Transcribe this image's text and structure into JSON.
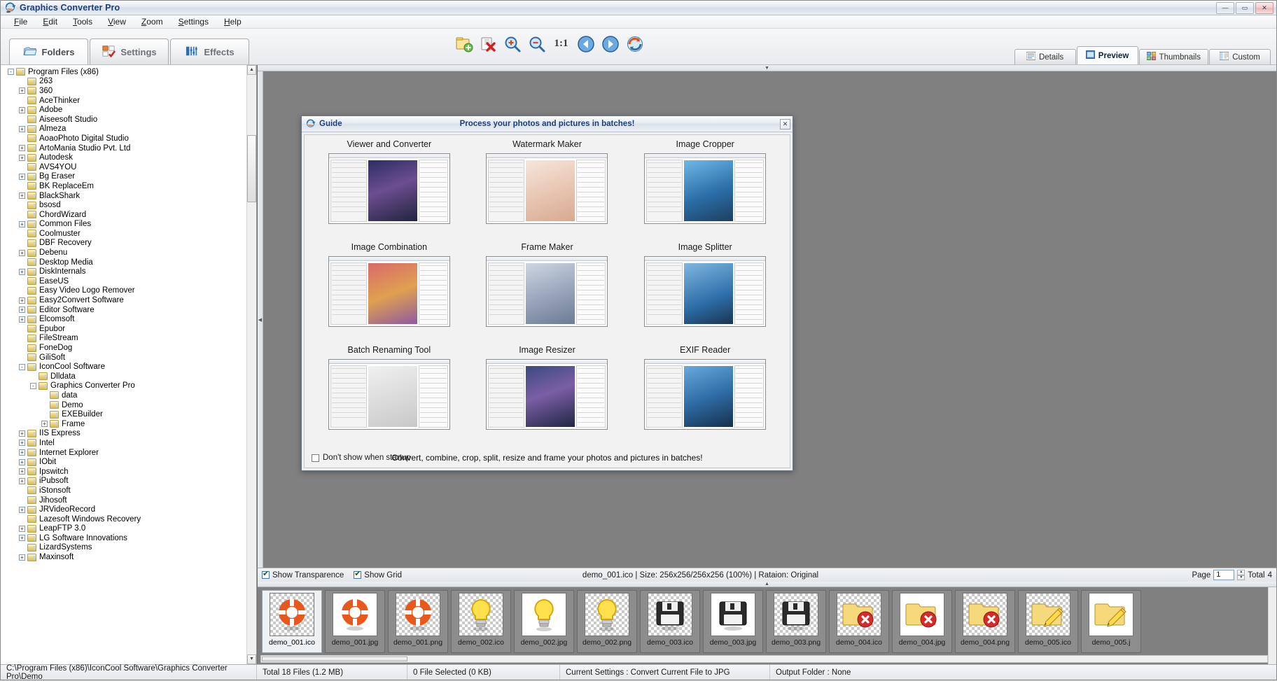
{
  "window": {
    "title": "Graphics Converter Pro",
    "buttons": {
      "minimize": "—",
      "maximize": "▭",
      "close": "✕"
    }
  },
  "menu": [
    {
      "label": "File"
    },
    {
      "label": "Edit"
    },
    {
      "label": "Tools"
    },
    {
      "label": "View"
    },
    {
      "label": "Zoom"
    },
    {
      "label": "Settings"
    },
    {
      "label": "Help"
    }
  ],
  "mode_tabs": [
    {
      "label": "Folders",
      "icon": "folder-icon",
      "active": true
    },
    {
      "label": "Settings",
      "icon": "settings-icon",
      "active": false
    },
    {
      "label": "Effects",
      "icon": "effects-icon",
      "active": false
    }
  ],
  "toolbar": [
    {
      "name": "add-files-icon",
      "glyph": "🗋"
    },
    {
      "name": "delete-icon",
      "glyph": "✖"
    },
    {
      "name": "zoom-in-icon",
      "glyph": "⊕"
    },
    {
      "name": "zoom-out-icon",
      "glyph": "⊖"
    },
    {
      "name": "actual-size-icon",
      "glyph": "1:1"
    },
    {
      "name": "previous-icon",
      "glyph": "◀"
    },
    {
      "name": "next-icon",
      "glyph": "▶"
    },
    {
      "name": "refresh-icon",
      "glyph": "↻"
    }
  ],
  "view_tabs": [
    {
      "label": "Details",
      "icon": "details-icon",
      "active": false
    },
    {
      "label": "Preview",
      "icon": "preview-icon",
      "active": true
    },
    {
      "label": "Thumbnails",
      "icon": "thumbnails-icon",
      "active": false
    },
    {
      "label": "Custom",
      "icon": "custom-icon",
      "active": false
    }
  ],
  "tree": [
    {
      "label": "Program Files (x86)",
      "depth": 2,
      "exp": "-"
    },
    {
      "label": "263",
      "depth": 3,
      "exp": ""
    },
    {
      "label": "360",
      "depth": 3,
      "exp": "+"
    },
    {
      "label": "AceThinker",
      "depth": 3,
      "exp": ""
    },
    {
      "label": "Adobe",
      "depth": 3,
      "exp": "+"
    },
    {
      "label": "Aiseesoft Studio",
      "depth": 3,
      "exp": ""
    },
    {
      "label": "Almeza",
      "depth": 3,
      "exp": "+"
    },
    {
      "label": "AoaoPhoto Digital Studio",
      "depth": 3,
      "exp": ""
    },
    {
      "label": "ArtoMania Studio Pvt. Ltd",
      "depth": 3,
      "exp": "+"
    },
    {
      "label": "Autodesk",
      "depth": 3,
      "exp": "+"
    },
    {
      "label": "AVS4YOU",
      "depth": 3,
      "exp": ""
    },
    {
      "label": "Bg Eraser",
      "depth": 3,
      "exp": "+"
    },
    {
      "label": "BK ReplaceEm",
      "depth": 3,
      "exp": ""
    },
    {
      "label": "BlackShark",
      "depth": 3,
      "exp": "+"
    },
    {
      "label": "bsosd",
      "depth": 3,
      "exp": ""
    },
    {
      "label": "ChordWizard",
      "depth": 3,
      "exp": ""
    },
    {
      "label": "Common Files",
      "depth": 3,
      "exp": "+"
    },
    {
      "label": "Coolmuster",
      "depth": 3,
      "exp": ""
    },
    {
      "label": "DBF Recovery",
      "depth": 3,
      "exp": ""
    },
    {
      "label": "Debenu",
      "depth": 3,
      "exp": "+"
    },
    {
      "label": "Desktop Media",
      "depth": 3,
      "exp": ""
    },
    {
      "label": "DiskInternals",
      "depth": 3,
      "exp": "+"
    },
    {
      "label": "EaseUS",
      "depth": 3,
      "exp": ""
    },
    {
      "label": "Easy Video Logo Remover",
      "depth": 3,
      "exp": ""
    },
    {
      "label": "Easy2Convert Software",
      "depth": 3,
      "exp": "+"
    },
    {
      "label": "Editor Software",
      "depth": 3,
      "exp": "+"
    },
    {
      "label": "Elcomsoft",
      "depth": 3,
      "exp": "+"
    },
    {
      "label": "Epubor",
      "depth": 3,
      "exp": ""
    },
    {
      "label": "FileStream",
      "depth": 3,
      "exp": ""
    },
    {
      "label": "FoneDog",
      "depth": 3,
      "exp": ""
    },
    {
      "label": "GiliSoft",
      "depth": 3,
      "exp": ""
    },
    {
      "label": "IconCool Software",
      "depth": 3,
      "exp": "-"
    },
    {
      "label": "Dlldata",
      "depth": 4,
      "exp": ""
    },
    {
      "label": "Graphics Converter Pro",
      "depth": 4,
      "exp": "-"
    },
    {
      "label": "data",
      "depth": 5,
      "exp": ""
    },
    {
      "label": "Demo",
      "depth": 5,
      "exp": ""
    },
    {
      "label": "EXEBuilder",
      "depth": 5,
      "exp": ""
    },
    {
      "label": "Frame",
      "depth": 5,
      "exp": "+"
    },
    {
      "label": "IIS Express",
      "depth": 3,
      "exp": "+"
    },
    {
      "label": "Intel",
      "depth": 3,
      "exp": "+"
    },
    {
      "label": "Internet Explorer",
      "depth": 3,
      "exp": "+"
    },
    {
      "label": "IObit",
      "depth": 3,
      "exp": "+"
    },
    {
      "label": "Ipswitch",
      "depth": 3,
      "exp": "+"
    },
    {
      "label": "iPubsoft",
      "depth": 3,
      "exp": "+"
    },
    {
      "label": "iStonsoft",
      "depth": 3,
      "exp": ""
    },
    {
      "label": "Jihosoft",
      "depth": 3,
      "exp": ""
    },
    {
      "label": "JRVideoRecord",
      "depth": 3,
      "exp": "+"
    },
    {
      "label": "Lazesoft Windows Recovery",
      "depth": 3,
      "exp": ""
    },
    {
      "label": "LeapFTP 3.0",
      "depth": 3,
      "exp": "+"
    },
    {
      "label": "LG Software Innovations",
      "depth": 3,
      "exp": "+"
    },
    {
      "label": "LizardSystems",
      "depth": 3,
      "exp": ""
    },
    {
      "label": "Maxinsoft",
      "depth": 3,
      "exp": "+"
    }
  ],
  "path_bar": {
    "value": "C:\\Program Files (x86)\\IconCool Software\\Graphics Converter Pro\\Demo"
  },
  "guide": {
    "title": "Guide",
    "subtitle": "Process your photos and pictures in batches!",
    "close_label": "✕",
    "items": [
      {
        "label": "Viewer and Converter"
      },
      {
        "label": "Watermark Maker"
      },
      {
        "label": "Image Cropper"
      },
      {
        "label": "Image Combination"
      },
      {
        "label": "Frame Maker"
      },
      {
        "label": "Image Splitter"
      },
      {
        "label": "Batch Renaming Tool"
      },
      {
        "label": "Image Resizer"
      },
      {
        "label": "EXIF Reader"
      }
    ],
    "dont_show_label": "Don't show when startup",
    "footer_text": "Convert, combine, crop, split, resize and frame your photos and pictures in batches!"
  },
  "options": {
    "show_transparence": "Show Transparence",
    "show_grid": "Show Grid",
    "info": "demo_001.ico | Size: 256x256/256x256 (100%) | Rataion: Original",
    "page_label": "Page",
    "page_value": "1",
    "total_label": "Total",
    "total_value": "4"
  },
  "thumbnails": [
    {
      "label": "demo_001.ico",
      "kind": "lifebuoy",
      "transparent": true,
      "selected": true
    },
    {
      "label": "demo_001.jpg",
      "kind": "lifebuoy",
      "transparent": false,
      "selected": false
    },
    {
      "label": "demo_001.png",
      "kind": "lifebuoy",
      "transparent": true,
      "selected": false
    },
    {
      "label": "demo_002.ico",
      "kind": "bulb",
      "transparent": true,
      "selected": false
    },
    {
      "label": "demo_002.jpg",
      "kind": "bulb",
      "transparent": false,
      "selected": false
    },
    {
      "label": "demo_002.png",
      "kind": "bulb",
      "transparent": true,
      "selected": false
    },
    {
      "label": "demo_003.ico",
      "kind": "floppy",
      "transparent": true,
      "selected": false
    },
    {
      "label": "demo_003.jpg",
      "kind": "floppy",
      "transparent": false,
      "selected": false
    },
    {
      "label": "demo_003.png",
      "kind": "floppy",
      "transparent": true,
      "selected": false
    },
    {
      "label": "demo_004.ico",
      "kind": "delete",
      "transparent": true,
      "selected": false
    },
    {
      "label": "demo_004.jpg",
      "kind": "delete",
      "transparent": false,
      "selected": false
    },
    {
      "label": "demo_004.png",
      "kind": "delete",
      "transparent": true,
      "selected": false
    },
    {
      "label": "demo_005.ico",
      "kind": "pencil",
      "transparent": true,
      "selected": false
    },
    {
      "label": "demo_005.j",
      "kind": "pencil",
      "transparent": false,
      "selected": false
    }
  ],
  "statusbar": {
    "total_files": "Total 18 Files (1.2 MB)",
    "selected": "0 File Selected (0 KB)",
    "current_settings": "Current Settings : Convert Current File to JPG",
    "output_folder": "Output Folder : None"
  },
  "colors": {
    "title_text": "#1c3f7a",
    "preview_bg": "#808080",
    "accent": "#3a6ea5"
  }
}
